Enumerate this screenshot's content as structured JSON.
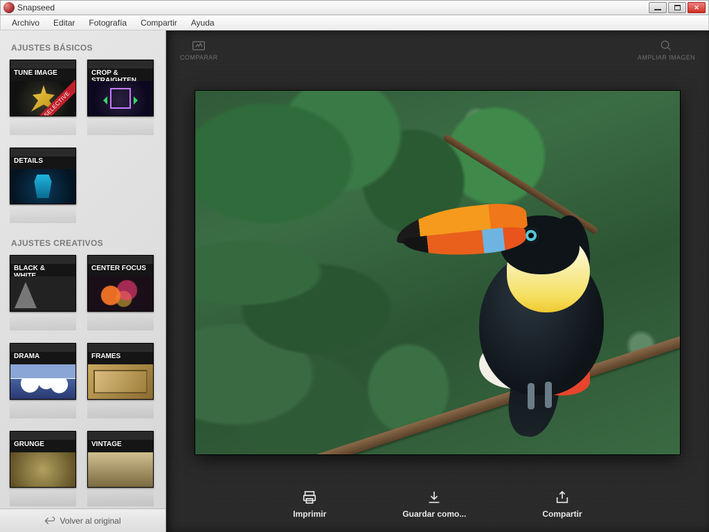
{
  "window": {
    "title": "Snapseed"
  },
  "menubar": [
    "Archivo",
    "Editar",
    "Fotografía",
    "Compartir",
    "Ayuda"
  ],
  "top_tools": {
    "compare": "COMPARAR",
    "zoom": "AMPLIAR IMAGEN"
  },
  "sidebar": {
    "section_basic_title": "AJUSTES BÁSICOS",
    "section_creative_title": "AJUSTES CREATIVOS",
    "basic": [
      {
        "label": "TUNE IMAGE",
        "ribbon": "SELECTIVE",
        "art": "art-tune"
      },
      {
        "label": "CROP & STRAIGHTEN",
        "art": "art-crop"
      },
      {
        "label": "DETAILS",
        "art": "art-details"
      }
    ],
    "creative": [
      {
        "label": "BLACK & WHITE",
        "art": "art-bw"
      },
      {
        "label": "CENTER FOCUS",
        "art": "art-center"
      },
      {
        "label": "DRAMA",
        "art": "art-drama"
      },
      {
        "label": "FRAMES",
        "art": "art-frames"
      },
      {
        "label": "GRUNGE",
        "art": "art-grunge"
      },
      {
        "label": "VINTAGE",
        "art": "art-vintage"
      }
    ],
    "revert_label": "Volver al original"
  },
  "actions": {
    "print": "Imprimir",
    "save_as": "Guardar como...",
    "share": "Compartir"
  }
}
